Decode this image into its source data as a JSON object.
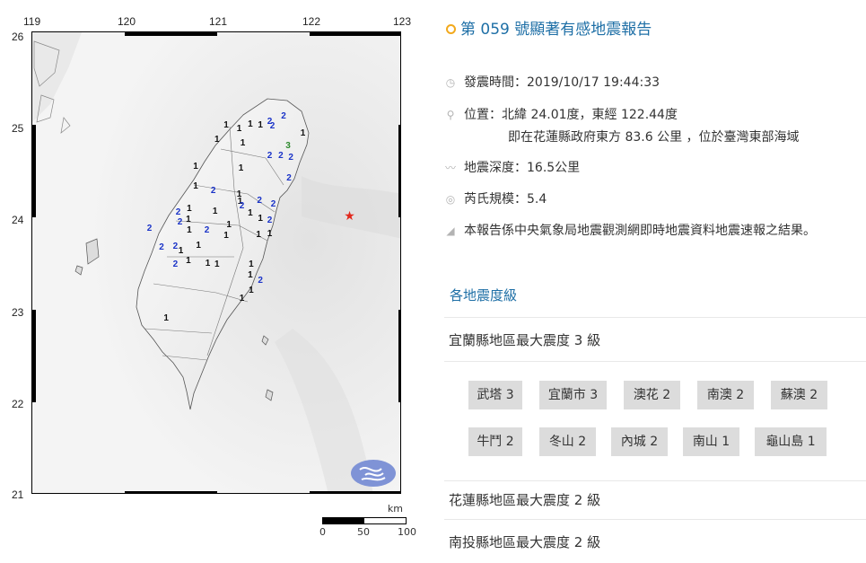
{
  "map": {
    "lon_labels": [
      "119",
      "120",
      "121",
      "122",
      "123"
    ],
    "lat_labels": [
      "26",
      "25",
      "24",
      "23",
      "22",
      "21"
    ],
    "intensity_labels": [
      {
        "v": "1",
        "c": "k",
        "lon": 121.1,
        "lat": 24.99
      },
      {
        "v": "1",
        "c": "k",
        "lon": 121.24,
        "lat": 24.95
      },
      {
        "v": "1",
        "c": "k",
        "lon": 121.36,
        "lat": 25.0
      },
      {
        "v": "1",
        "c": "k",
        "lon": 121.47,
        "lat": 24.99
      },
      {
        "v": "2",
        "c": "b",
        "lon": 121.57,
        "lat": 25.03
      },
      {
        "v": "2",
        "c": "b",
        "lon": 121.6,
        "lat": 24.98
      },
      {
        "v": "2",
        "c": "b",
        "lon": 121.72,
        "lat": 25.09
      },
      {
        "v": "1",
        "c": "k",
        "lon": 121.93,
        "lat": 24.9
      },
      {
        "v": "1",
        "c": "k",
        "lon": 121.0,
        "lat": 24.84
      },
      {
        "v": "1",
        "c": "k",
        "lon": 121.28,
        "lat": 24.8
      },
      {
        "v": "3",
        "c": "g",
        "lon": 121.77,
        "lat": 24.77
      },
      {
        "v": "2",
        "c": "b",
        "lon": 121.57,
        "lat": 24.66
      },
      {
        "v": "2",
        "c": "b",
        "lon": 121.69,
        "lat": 24.66
      },
      {
        "v": "2",
        "c": "b",
        "lon": 121.8,
        "lat": 24.64
      },
      {
        "v": "1",
        "c": "k",
        "lon": 120.77,
        "lat": 24.54
      },
      {
        "v": "1",
        "c": "k",
        "lon": 121.26,
        "lat": 24.52
      },
      {
        "v": "2",
        "c": "b",
        "lon": 121.78,
        "lat": 24.42
      },
      {
        "v": "1",
        "c": "k",
        "lon": 120.77,
        "lat": 24.33
      },
      {
        "v": "2",
        "c": "b",
        "lon": 120.96,
        "lat": 24.28
      },
      {
        "v": "1",
        "c": "k",
        "lon": 121.24,
        "lat": 24.24
      },
      {
        "v": "2",
        "c": "b",
        "lon": 121.46,
        "lat": 24.18
      },
      {
        "v": "1",
        "c": "k",
        "lon": 121.25,
        "lat": 24.17
      },
      {
        "v": "2",
        "c": "b",
        "lon": 121.27,
        "lat": 24.12
      },
      {
        "v": "2",
        "c": "b",
        "lon": 121.61,
        "lat": 24.14
      },
      {
        "v": "2",
        "c": "b",
        "lon": 120.58,
        "lat": 24.05
      },
      {
        "v": "1",
        "c": "k",
        "lon": 120.7,
        "lat": 24.09
      },
      {
        "v": "1",
        "c": "k",
        "lon": 120.98,
        "lat": 24.06
      },
      {
        "v": "1",
        "c": "k",
        "lon": 121.36,
        "lat": 24.04
      },
      {
        "v": "2",
        "c": "b",
        "lon": 120.6,
        "lat": 23.94
      },
      {
        "v": "1",
        "c": "k",
        "lon": 120.69,
        "lat": 23.97
      },
      {
        "v": "1",
        "c": "k",
        "lon": 121.47,
        "lat": 23.98
      },
      {
        "v": "2",
        "c": "b",
        "lon": 121.57,
        "lat": 23.96
      },
      {
        "v": "1",
        "c": "k",
        "lon": 121.13,
        "lat": 23.91
      },
      {
        "v": "2",
        "c": "b",
        "lon": 120.27,
        "lat": 23.87
      },
      {
        "v": "1",
        "c": "k",
        "lon": 120.7,
        "lat": 23.85
      },
      {
        "v": "2",
        "c": "b",
        "lon": 120.89,
        "lat": 23.85
      },
      {
        "v": "1",
        "c": "k",
        "lon": 121.45,
        "lat": 23.81
      },
      {
        "v": "1",
        "c": "k",
        "lon": 121.57,
        "lat": 23.82
      },
      {
        "v": "1",
        "c": "k",
        "lon": 121.1,
        "lat": 23.8
      },
      {
        "v": "2",
        "c": "b",
        "lon": 120.4,
        "lat": 23.67
      },
      {
        "v": "2",
        "c": "b",
        "lon": 120.55,
        "lat": 23.68
      },
      {
        "v": "1",
        "c": "k",
        "lon": 120.61,
        "lat": 23.63
      },
      {
        "v": "1",
        "c": "k",
        "lon": 120.8,
        "lat": 23.69
      },
      {
        "v": "1",
        "c": "k",
        "lon": 120.69,
        "lat": 23.52
      },
      {
        "v": "1",
        "c": "k",
        "lon": 120.9,
        "lat": 23.5
      },
      {
        "v": "1",
        "c": "k",
        "lon": 121.0,
        "lat": 23.49
      },
      {
        "v": "1",
        "c": "k",
        "lon": 121.37,
        "lat": 23.49
      },
      {
        "v": "2",
        "c": "b",
        "lon": 120.55,
        "lat": 23.49
      },
      {
        "v": "1",
        "c": "k",
        "lon": 121.36,
        "lat": 23.37
      },
      {
        "v": "2",
        "c": "b",
        "lon": 121.47,
        "lat": 23.31
      },
      {
        "v": "1",
        "c": "k",
        "lon": 121.37,
        "lat": 23.2
      },
      {
        "v": "1",
        "c": "k",
        "lon": 121.27,
        "lat": 23.12
      },
      {
        "v": "1",
        "c": "k",
        "lon": 120.45,
        "lat": 22.9
      }
    ],
    "epicenter": {
      "lon": 122.44,
      "lat": 24.01,
      "symbol": "★"
    },
    "scale": {
      "unit": "km",
      "ticks": [
        "0",
        "50",
        "100"
      ]
    }
  },
  "report": {
    "title": "第 059 號顯著有感地震報告",
    "time_label": "發震時間：2019/10/17 19:44:33",
    "location_line1": "位置：北緯 24.01度，東經 122.44度",
    "location_line2": "即在花蓮縣政府東方 83.6 公里 ，位於臺灣東部海域",
    "depth_label": "地震深度：16.5公里",
    "magnitude_label": "芮氏規模：5.4",
    "note": "本報告係中央氣象局地震觀測網即時地震資料地震速報之結果。",
    "section_title": "各地震度級",
    "county_yilan": "宜蘭縣地區最大震度 3 級",
    "stations": [
      "武塔 3",
      "宜蘭市 3",
      "澳花 2",
      "南澳 2",
      "蘇澳 2",
      "牛鬥 2",
      "冬山 2",
      "內城 2",
      "南山 1",
      "龜山島 1"
    ],
    "county_hualien": "花蓮縣地區最大震度 2 級",
    "county_nantou": "南投縣地區最大震度 2 級"
  }
}
